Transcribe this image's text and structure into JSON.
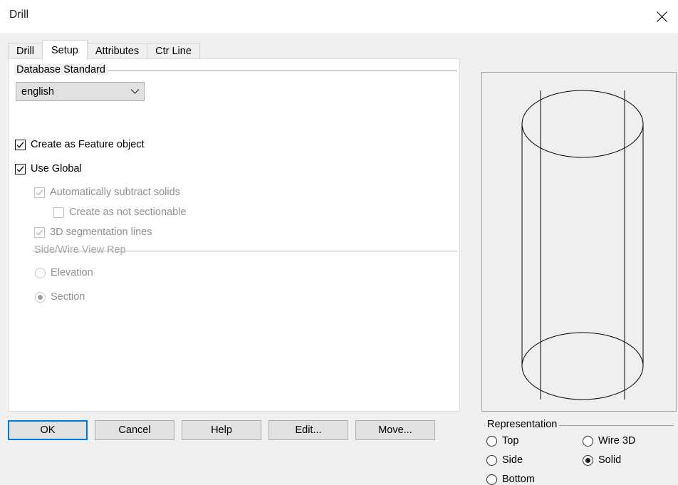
{
  "window": {
    "title": "Drill",
    "close_icon": "close-icon"
  },
  "tabs": [
    {
      "label": "Drill",
      "active": false
    },
    {
      "label": "Setup",
      "active": true
    },
    {
      "label": "Attributes",
      "active": false
    },
    {
      "label": "Ctr Line",
      "active": false
    }
  ],
  "setup": {
    "database_standard": {
      "group_label": "Database Standard",
      "combo_value": "english",
      "combo_arrow_icon": "chevron-down-icon",
      "options": [
        "english"
      ]
    },
    "checkboxes": [
      {
        "label": "Create as Feature object",
        "checked": true,
        "enabled": true
      },
      {
        "label": "Use Global",
        "checked": true,
        "enabled": true
      },
      {
        "label": "Automatically subtract solids",
        "checked": true,
        "enabled": false
      },
      {
        "label": "Create as not sectionable",
        "checked": false,
        "enabled": false
      },
      {
        "label": "3D segmentation lines",
        "checked": true,
        "enabled": false
      }
    ],
    "side_wire_view_rep": {
      "group_label": "Side/Wire View Rep",
      "enabled": false,
      "options": [
        {
          "label": "Elevation",
          "selected": false
        },
        {
          "label": "Section",
          "selected": true
        }
      ]
    }
  },
  "preview": {
    "shape_name": "cylinder-wireframe"
  },
  "representation": {
    "group_label": "Representation",
    "options_left": [
      {
        "label": "Top",
        "selected": false
      },
      {
        "label": "Side",
        "selected": false
      },
      {
        "label": "Bottom",
        "selected": false
      }
    ],
    "options_right": [
      {
        "label": "Wire 3D",
        "selected": false
      },
      {
        "label": "Solid",
        "selected": true
      }
    ]
  },
  "buttons": [
    {
      "label": "OK",
      "default": true
    },
    {
      "label": "Cancel",
      "default": false
    },
    {
      "label": "Help",
      "default": false
    },
    {
      "label": "Edit...",
      "default": false
    },
    {
      "label": "Move...",
      "default": false
    }
  ],
  "colors": {
    "window_bg": "#f0f0f0",
    "titlebar_bg": "#ffffff",
    "panel_bg": "#ffffff",
    "control_bg": "#e1e1e1",
    "control_border": "#adadad",
    "accent": "#0078d7",
    "disabled_text": "#8e8e8e",
    "group_line": "#9a9a9a",
    "preview_border": "#a3a3a3",
    "preview_bg": "#efefef",
    "line_color": "#000000"
  }
}
